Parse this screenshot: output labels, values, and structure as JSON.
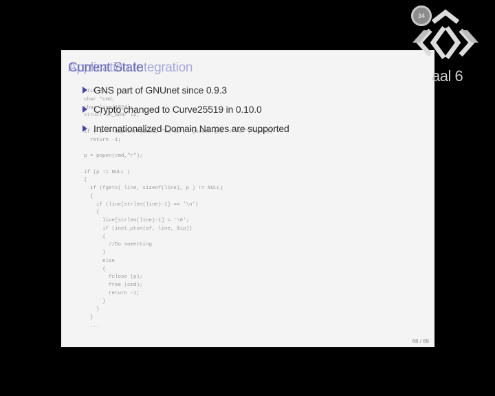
{
  "slide": {
    "title_ghost": "Application Integration",
    "title": "Current State",
    "bullets": [
      "GNS part of GNUnet since 0.9.3",
      "Crypto changed to Curve25519 in 0.10.0",
      "Internationalized Domain Names are supported"
    ],
    "code_lines": "FILE *p;\nchar *cmd;\nchar line[1024];\nstruct in_addr ip;\n\nif (-1 == asprintf(&cmd, \"%s %s\", \"gnunet-gns -r -u \", name))\n  return -1;\n\np = popen(cmd,\"r\");\n\nif (p != NULL )\n{\n  if (fgets( line, sizeof(line), p ) != NULL)\n  {\n    if (line[strlen(line)-1] == '\\n')\n    {\n      line[strlen(line)-1] = '\\0';\n      if (inet_pton(af, line, &ip))\n      {\n        //Do something\n      }\n      else\n      {\n        fclose (p);\n        free (cmd);\n        return -1;\n      }\n    }\n  }\n  ...",
    "page_number": "68 / 69"
  },
  "overlay": {
    "badge_number": "34",
    "room_label": "aal 6"
  },
  "colors": {
    "background": "#000000",
    "slide_background": "#f4f4f4",
    "title": "#6363b4",
    "bullet_marker": "#4444aa"
  }
}
